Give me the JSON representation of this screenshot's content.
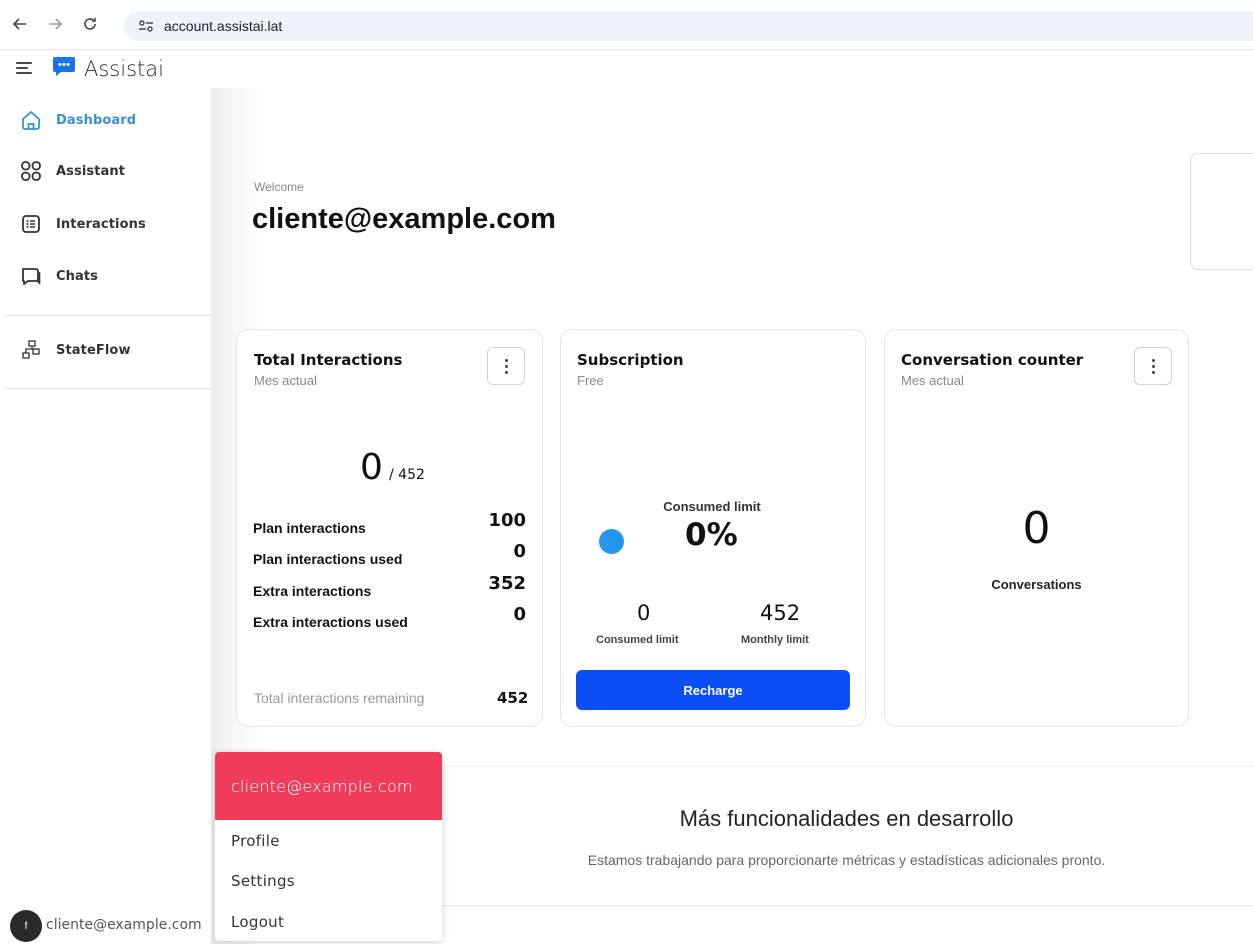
{
  "browser": {
    "url": "account.assistai.lat",
    "back_icon": "arrow-left",
    "forward_icon": "arrow-right",
    "reload_icon": "reload"
  },
  "app": {
    "brand": "Assistai",
    "brand_color": "#1a73e8"
  },
  "sidebar": {
    "items": [
      {
        "label": "Dashboard",
        "icon": "home-icon",
        "active": true
      },
      {
        "label": "Assistant",
        "icon": "grid-icon"
      },
      {
        "label": "Interactions",
        "icon": "list-icon"
      },
      {
        "label": "Chats",
        "icon": "chat-icon"
      },
      {
        "label": "StateFlow",
        "icon": "flow-icon"
      }
    ],
    "active_color": "#3a8fd1"
  },
  "welcome": {
    "label": "Welcome",
    "email": "cliente@example.com"
  },
  "cards": {
    "total_interactions": {
      "title": "Total Interactions",
      "subtitle": "Mes actual",
      "used": "0",
      "total": "/ 452",
      "rows": [
        {
          "label": "Plan interactions",
          "value": "100"
        },
        {
          "label": "Plan interactions used",
          "value": "0"
        },
        {
          "label": "Extra interactions",
          "value": "352"
        },
        {
          "label": "Extra interactions used",
          "value": "0"
        }
      ],
      "remaining_label": "Total interactions remaining",
      "remaining_value": "452"
    },
    "subscription": {
      "title": "Subscription",
      "subtitle": "Free",
      "consumed_caption": "Consumed limit",
      "consumed_percent": "0%",
      "consumed_value": "0",
      "consumed_label": "Consumed limit",
      "monthly_value": "452",
      "monthly_label": "Monthly limit",
      "recharge_label": "Recharge",
      "accent": "#0b4ef5",
      "dot_color": "#2596f0"
    },
    "conversation_counter": {
      "title": "Conversation counter",
      "subtitle": "Mes actual",
      "value": "0",
      "label": "Conversations"
    }
  },
  "more": {
    "title": "Más funcionalidades en desarrollo",
    "description": "Estamos trabajando para proporcionarte métricas y estadísticas adicionales pronto."
  },
  "user_menu": {
    "header": "cliente@example.com",
    "header_color": "#f03c5a",
    "items": [
      "Profile",
      "Settings",
      "Logout"
    ]
  },
  "footer_user": {
    "avatar_letter": "f",
    "email": "cliente@example.com"
  }
}
